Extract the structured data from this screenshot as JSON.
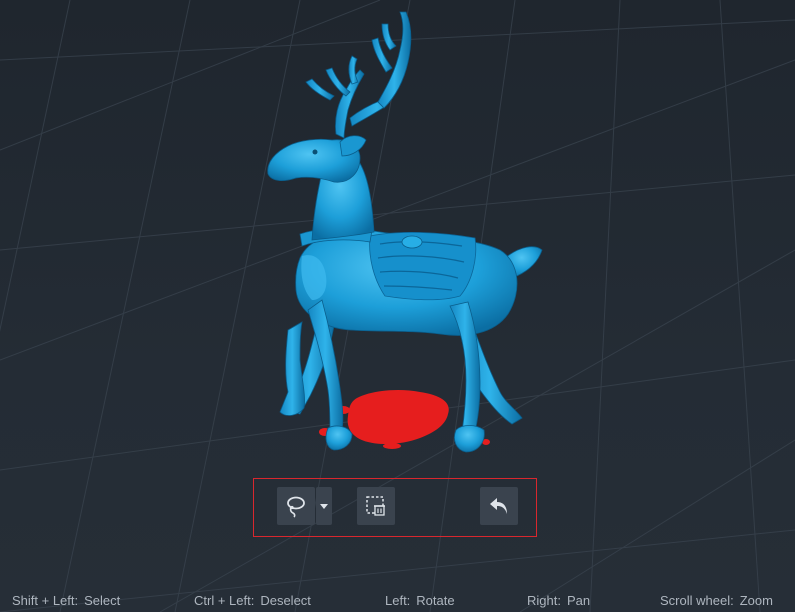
{
  "toolbar": {
    "tools": [
      {
        "name": "lasso-select",
        "icon": "lasso-icon",
        "has_dropdown": true
      },
      {
        "name": "delete-selection",
        "icon": "delete-selection-icon"
      },
      {
        "name": "undo",
        "icon": "undo-icon"
      }
    ],
    "highlight_color": "#d9272e"
  },
  "model": {
    "color": "#1d9fd9",
    "selection_color": "#e61e1e"
  },
  "hints": [
    {
      "key": "Shift + Left:",
      "action": "Select"
    },
    {
      "key": "Ctrl + Left:",
      "action": "Deselect"
    },
    {
      "key": "Left:",
      "action": "Rotate"
    },
    {
      "key": "Right:",
      "action": "Pan"
    },
    {
      "key": "Scroll wheel:",
      "action": "Zoom"
    }
  ]
}
